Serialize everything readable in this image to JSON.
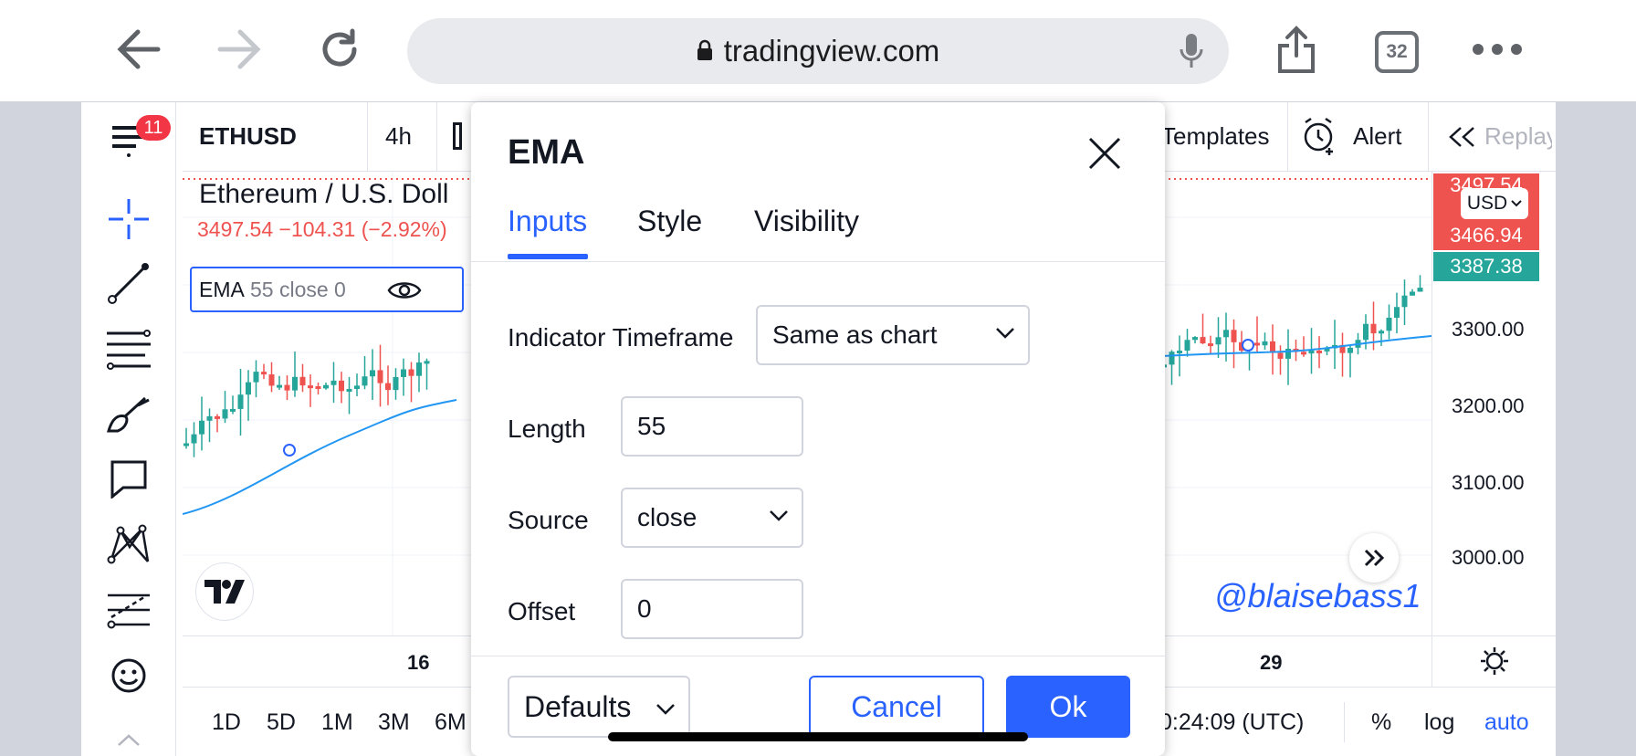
{
  "browser": {
    "url": "tradingview.com",
    "tabs_count": "32",
    "icons": [
      "back-arrow-icon",
      "forward-arrow-icon",
      "reload-icon",
      "lock-icon",
      "microphone-icon",
      "share-icon",
      "more-icon"
    ]
  },
  "toolbar": {
    "menu_badge": "11",
    "symbol": "ETHUSD",
    "interval": "4h",
    "templates_label": "Templates",
    "alert_label": "Alert",
    "replay_label": "Replay"
  },
  "legend": {
    "title": "Ethereum / U.S. Doll",
    "ohlc": "3497.54  −104.31 (−2.92%)",
    "indicator_name": "EMA",
    "indicator_params": "55 close 0"
  },
  "price_axis": {
    "currency": "USD",
    "labels": [
      "3300.00",
      "3200.00",
      "3100.00",
      "3000.00"
    ],
    "tags": [
      {
        "value": "3497.54",
        "color": "#ef5350"
      },
      {
        "value": "3466.94",
        "color": "#ef5350"
      },
      {
        "value": "3387.38",
        "color": "#26a69a"
      }
    ]
  },
  "time_axis": {
    "labels": [
      "16",
      "29"
    ]
  },
  "bottom_bar": {
    "ranges": [
      "1D",
      "5D",
      "1M",
      "3M",
      "6M"
    ],
    "clock": "0:24:09 (UTC)",
    "percent_label": "%",
    "log_label": "log",
    "auto_label": "auto"
  },
  "watermark": "@blaisebass1",
  "dialog": {
    "title": "EMA",
    "tabs": [
      "Inputs",
      "Style",
      "Visibility"
    ],
    "active_tab": "Inputs",
    "fields": [
      {
        "label": "Indicator Timeframe",
        "value": "Same as chart"
      },
      {
        "label": "Length",
        "value": "55"
      },
      {
        "label": "Source",
        "value": "close"
      },
      {
        "label": "Offset",
        "value": "0"
      }
    ],
    "defaults_label": "Defaults",
    "cancel_label": "Cancel",
    "ok_label": "Ok"
  },
  "colors": {
    "accent": "#2962ff",
    "up": "#26a69a",
    "down": "#ef5350",
    "ema": "#2196f3"
  }
}
